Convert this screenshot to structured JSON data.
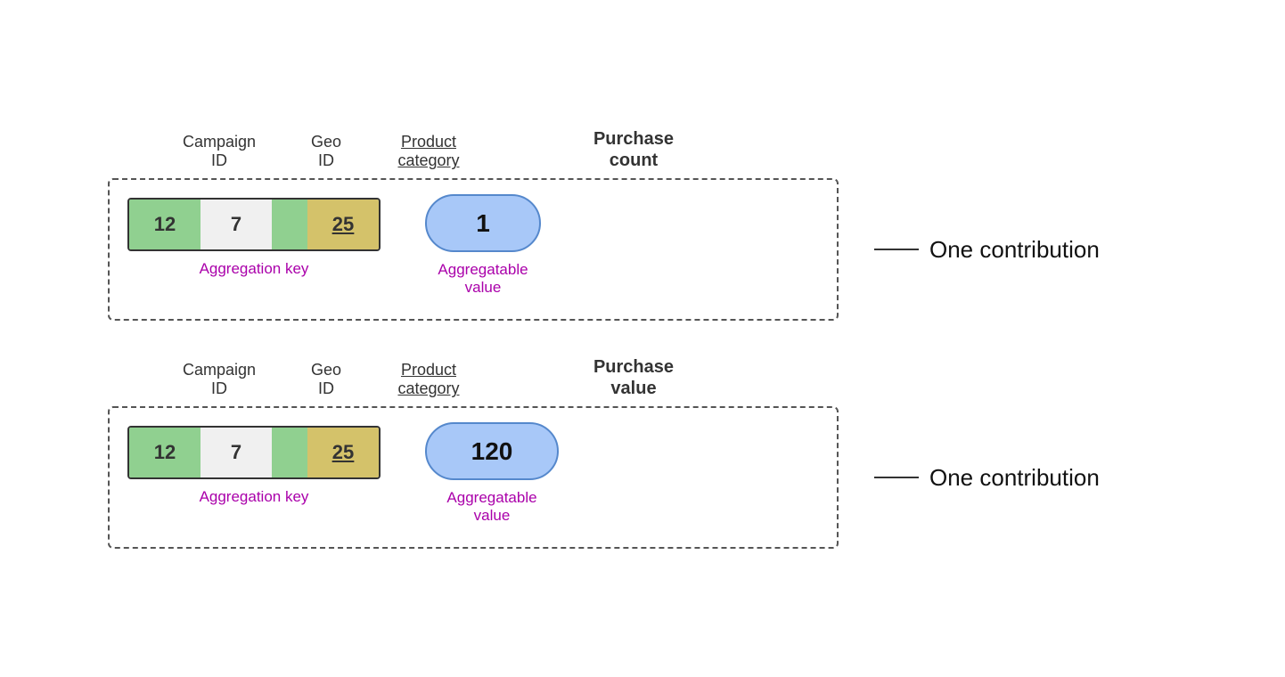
{
  "block1": {
    "col_campaign": "Campaign\nID",
    "col_geo": "Geo\nID",
    "col_product": "Product\ncategory",
    "col_metric": "Purchase\ncount",
    "campaign_val": "12",
    "geo_val": "7",
    "product_val": "25",
    "metric_val": "1",
    "agg_key_label": "Aggregation key",
    "agg_value_label": "Aggregatable\nvalue",
    "contribution_label": "One contribution"
  },
  "block2": {
    "col_campaign": "Campaign\nID",
    "col_geo": "Geo\nID",
    "col_product": "Product\ncategory",
    "col_metric": "Purchase\nvalue",
    "campaign_val": "12",
    "geo_val": "7",
    "product_val": "25",
    "metric_val": "120",
    "agg_key_label": "Aggregation key",
    "agg_value_label": "Aggregatable\nvalue",
    "contribution_label": "One contribution"
  }
}
